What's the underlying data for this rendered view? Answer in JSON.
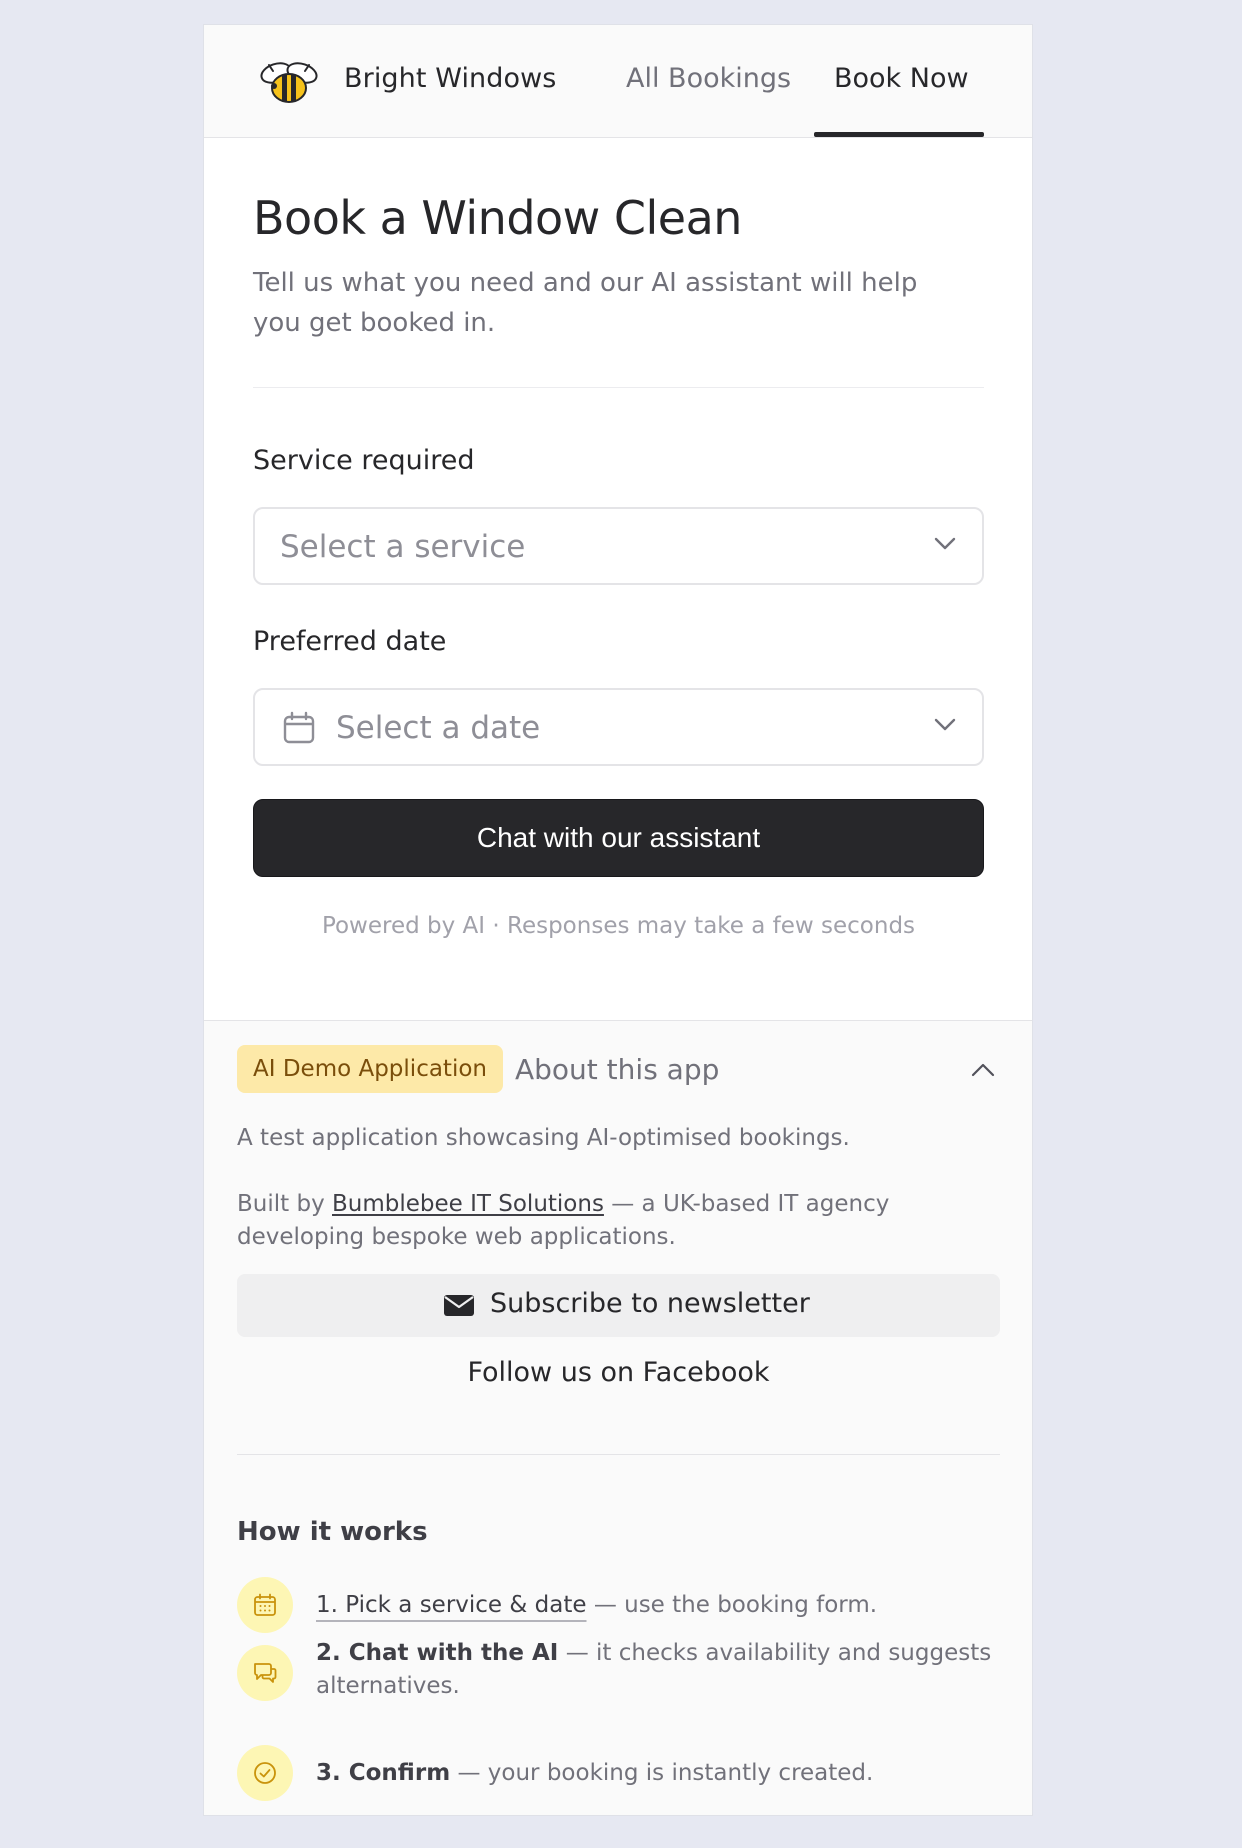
{
  "header": {
    "brand": "Bright Windows",
    "nav": {
      "all_bookings": "All Bookings",
      "book_now": "Book Now"
    }
  },
  "main": {
    "title": "Book a Window Clean",
    "subtitle": "Tell us what you need and our AI assistant will help you get booked in.",
    "service": {
      "label": "Service required",
      "placeholder": "Select a service"
    },
    "date": {
      "label": "Preferred date",
      "placeholder": "Select a date"
    },
    "cta": "Chat with our assistant",
    "powered": "Powered by AI · Responses may take a few seconds"
  },
  "about": {
    "badge": "AI Demo Application",
    "title": "About this app",
    "description": "A test application showcasing AI-optimised bookings.",
    "built_prefix": "Built by",
    "built_link": "Bumblebee IT Solutions",
    "built_suffix": "— a UK-based IT agency developing bespoke web applications.",
    "subscribe": "Subscribe to newsletter",
    "facebook": "Follow us on Facebook",
    "how_it_works": {
      "title": "How it works",
      "steps": [
        {
          "title": "1. Pick a service & date",
          "text": "— use the booking form."
        },
        {
          "title": "2. Chat with the AI",
          "text": "— it checks availability and suggests alternatives."
        },
        {
          "title": "3. Confirm",
          "text": "— your booking is instantly created."
        }
      ]
    }
  },
  "colors": {
    "accent": "#27272a",
    "badge_bg": "#fde9a8",
    "badge_text": "#7a4e0b",
    "step_icon_bg": "#fdf6b4",
    "page_bg": "#e6e8f2"
  },
  "icons": {
    "logo": "bee-icon",
    "service_chevron": "chevron-down-icon",
    "date_calendar": "calendar-icon",
    "date_chevron": "chevron-down-icon",
    "about_toggle": "chevron-up-icon",
    "subscribe": "mail-icon",
    "step1": "calendar-icon",
    "step2": "chat-icon",
    "step3": "check-circle-icon"
  }
}
